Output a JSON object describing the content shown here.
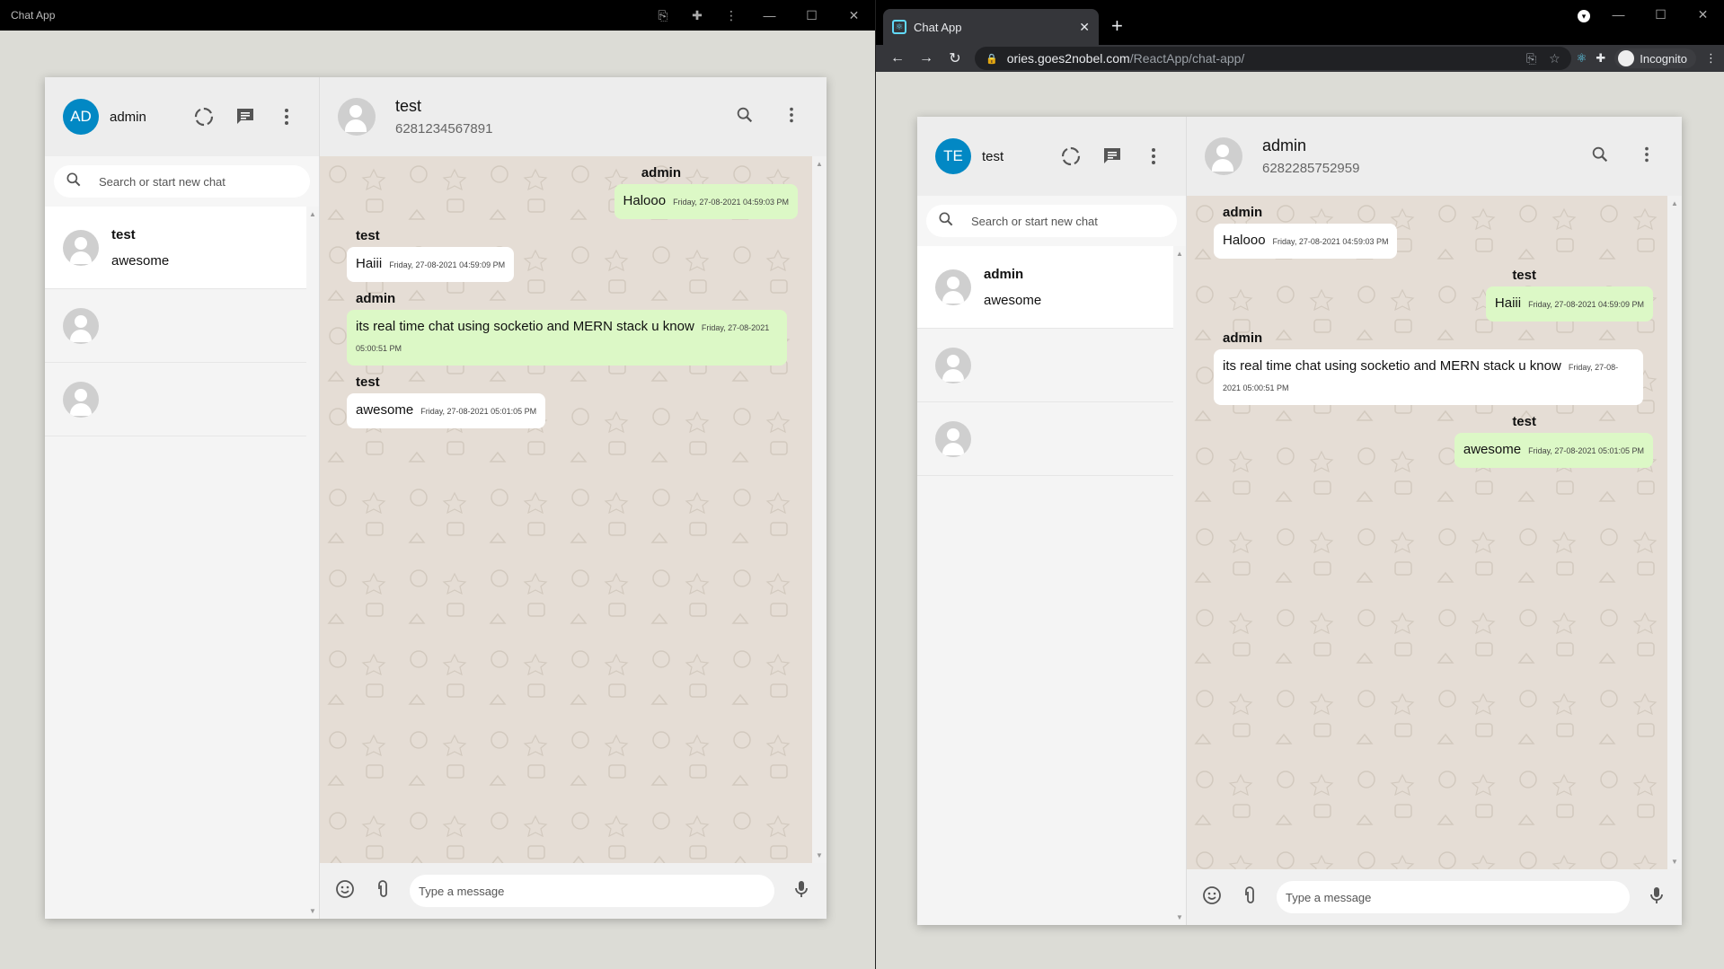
{
  "left_window": {
    "title": "Chat App",
    "app": {
      "user": {
        "initials": "AD",
        "name": "admin"
      },
      "search_placeholder": "Search or start new chat",
      "chats": [
        {
          "name": "test",
          "last_message": "awesome"
        },
        {
          "name": "",
          "last_message": ""
        },
        {
          "name": "",
          "last_message": ""
        }
      ],
      "contact": {
        "name": "test",
        "phone": "6281234567891"
      },
      "messages": [
        {
          "sender": "admin",
          "text": "Halooo",
          "time": "Friday, 27-08-2021 04:59:03 PM"
        },
        {
          "sender": "test",
          "text": "Haiii",
          "time": "Friday, 27-08-2021 04:59:09 PM"
        },
        {
          "sender": "admin",
          "text": "its real time chat using socketio and MERN stack u know",
          "time": "Friday, 27-08-2021 05:00:51 PM"
        },
        {
          "sender": "test",
          "text": "awesome",
          "time": "Friday, 27-08-2021 05:01:05 PM"
        }
      ],
      "input_placeholder": "Type a message"
    }
  },
  "right_window": {
    "tab_title": "Chat App",
    "url": {
      "host": "ories.goes2nobel.com",
      "path": "/ReactApp/chat-app/"
    },
    "profile_label": "Incognito",
    "app": {
      "user": {
        "initials": "TE",
        "name": "test"
      },
      "search_placeholder": "Search or start new chat",
      "chats": [
        {
          "name": "admin",
          "last_message": "awesome"
        },
        {
          "name": "",
          "last_message": ""
        },
        {
          "name": "",
          "last_message": ""
        }
      ],
      "contact": {
        "name": "admin",
        "phone": "6282285752959"
      },
      "messages": [
        {
          "sender": "admin",
          "text": "Halooo",
          "time": "Friday, 27-08-2021 04:59:03 PM"
        },
        {
          "sender": "test",
          "text": "Haiii",
          "time": "Friday, 27-08-2021 04:59:09 PM"
        },
        {
          "sender": "admin",
          "text": "its real time chat using socketio and MERN stack u know",
          "time": "Friday, 27-08-2021 05:00:51 PM"
        },
        {
          "sender": "test",
          "text": "awesome",
          "time": "Friday, 27-08-2021 05:01:05 PM"
        }
      ],
      "input_placeholder": "Type a message"
    }
  },
  "colors": {
    "own_bubble": "#dcf8c6",
    "other_bubble": "#ffffff",
    "avatar": "#0288c4",
    "chat_bg": "#e5ddd5"
  },
  "icons": [
    "translate-icon",
    "extension-icon",
    "more-vert-icon",
    "status-icon",
    "chat-icon",
    "search-icon",
    "emoji-icon",
    "attach-icon",
    "mic-icon",
    "back-icon",
    "forward-icon",
    "reload-icon",
    "lock-icon",
    "star-icon",
    "react-devtools-icon",
    "incognito-icon"
  ]
}
